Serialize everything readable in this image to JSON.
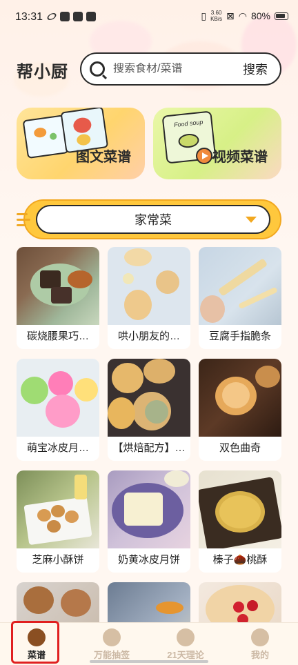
{
  "status_bar": {
    "time": "13:31",
    "net_speed_value": "3.60",
    "net_speed_unit": "KB/s",
    "battery": "80%"
  },
  "header": {
    "logo": "帮小厨",
    "search": {
      "placeholder": "搜索食材/菜谱",
      "button_label": "搜索"
    }
  },
  "banners": [
    {
      "label": "图文菜谱"
    },
    {
      "label": "视频菜谱",
      "note_text": "Food soup"
    }
  ],
  "category": {
    "selected": "家常菜"
  },
  "recipes": [
    {
      "title": "碳烧腰果巧…"
    },
    {
      "title": "哄小朋友的…"
    },
    {
      "title": "豆腐手指脆条"
    },
    {
      "title": "萌宝冰皮月…"
    },
    {
      "title": "【烘焙配方】…"
    },
    {
      "title": "双色曲奇"
    },
    {
      "title": "芝麻小酥饼"
    },
    {
      "title": "奶黄冰皮月饼"
    },
    {
      "title": "榛子🌰桃酥"
    },
    {
      "title": ""
    },
    {
      "title": ""
    },
    {
      "title": ""
    }
  ],
  "bottom_nav": {
    "items": [
      {
        "label": "菜谱",
        "active": true
      },
      {
        "label": "万能抽签",
        "active": false
      },
      {
        "label": "21天理论",
        "active": false
      },
      {
        "label": "我的",
        "active": false
      }
    ]
  },
  "colors": {
    "accent_yellow": "#ffc83d",
    "active_nav": "#8a4f22",
    "highlight_box": "#e02020"
  }
}
